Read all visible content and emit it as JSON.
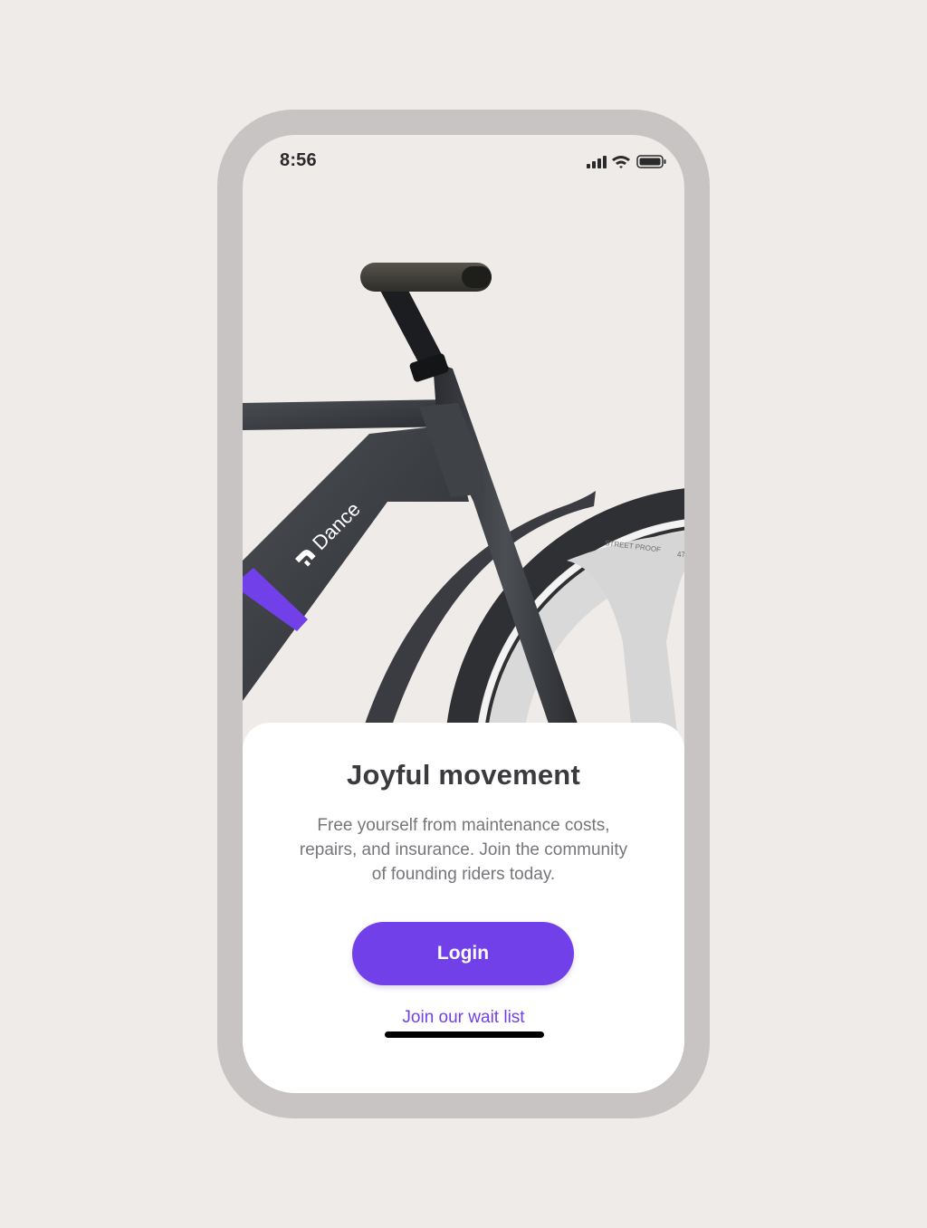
{
  "status_bar": {
    "time": "8:56",
    "icons": [
      "cellular-signal-icon",
      "wifi-icon",
      "battery-icon"
    ]
  },
  "hero": {
    "brand_text": "Dance",
    "tire_text": "STREET PROOF",
    "tire_size_text": "47"
  },
  "card": {
    "title": "Joyful movement",
    "body_line_1": "Free yourself from maintenance costs,",
    "body_line_2": "repairs, and insurance. Join the community",
    "body_line_3": "of founding riders today.",
    "login_label": "Login",
    "wait_list_label": "Join our wait list"
  },
  "colors": {
    "background": "#efebe8",
    "phone_frame": "#c9c4c4",
    "accent": "#7140e8",
    "title_text": "#3b3a3f",
    "body_text": "#77757a"
  }
}
